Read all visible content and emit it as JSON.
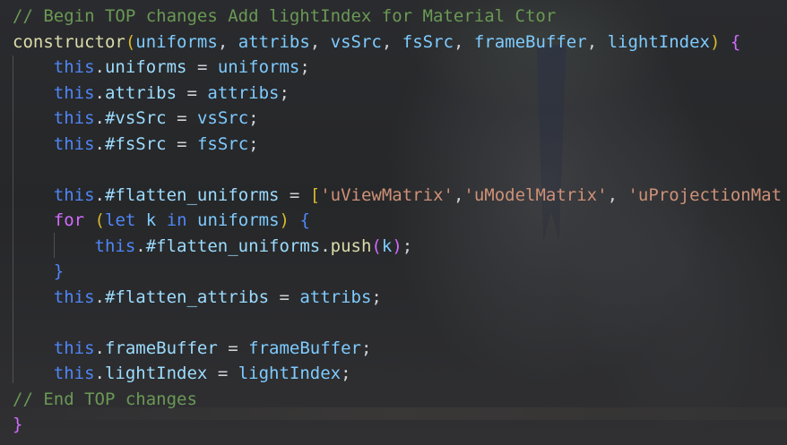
{
  "editor": {
    "lines": [
      {
        "tokens": [
          {
            "t": "// Begin TOP changes Add lightIndex for Material Ctor",
            "c": "cmt"
          }
        ]
      },
      {
        "tokens": [
          {
            "t": "constructor",
            "c": "fn"
          },
          {
            "t": "(",
            "c": "br2"
          },
          {
            "t": "uniforms",
            "c": "var"
          },
          {
            "t": ", ",
            "c": "plain"
          },
          {
            "t": "attribs",
            "c": "var"
          },
          {
            "t": ", ",
            "c": "plain"
          },
          {
            "t": "vsSrc",
            "c": "var"
          },
          {
            "t": ", ",
            "c": "plain"
          },
          {
            "t": "fsSrc",
            "c": "var"
          },
          {
            "t": ", ",
            "c": "plain"
          },
          {
            "t": "frameBuffer",
            "c": "var"
          },
          {
            "t": ", ",
            "c": "plain"
          },
          {
            "t": "lightIndex",
            "c": "var"
          },
          {
            "t": ")",
            "c": "br2"
          },
          {
            "t": " ",
            "c": "plain"
          },
          {
            "t": "{",
            "c": "br1"
          }
        ]
      },
      {
        "tokens": [
          {
            "t": "    ",
            "c": "plain"
          },
          {
            "t": "this",
            "c": "kw"
          },
          {
            "t": ".",
            "c": "plain"
          },
          {
            "t": "uniforms",
            "c": "prop"
          },
          {
            "t": " = ",
            "c": "plain"
          },
          {
            "t": "uniforms",
            "c": "var"
          },
          {
            "t": ";",
            "c": "plain"
          }
        ]
      },
      {
        "tokens": [
          {
            "t": "    ",
            "c": "plain"
          },
          {
            "t": "this",
            "c": "kw"
          },
          {
            "t": ".",
            "c": "plain"
          },
          {
            "t": "attribs",
            "c": "prop"
          },
          {
            "t": " = ",
            "c": "plain"
          },
          {
            "t": "attribs",
            "c": "var"
          },
          {
            "t": ";",
            "c": "plain"
          }
        ]
      },
      {
        "tokens": [
          {
            "t": "    ",
            "c": "plain"
          },
          {
            "t": "this",
            "c": "kw"
          },
          {
            "t": ".",
            "c": "plain"
          },
          {
            "t": "#vsSrc",
            "c": "prop"
          },
          {
            "t": " = ",
            "c": "plain"
          },
          {
            "t": "vsSrc",
            "c": "var"
          },
          {
            "t": ";",
            "c": "plain"
          }
        ]
      },
      {
        "tokens": [
          {
            "t": "    ",
            "c": "plain"
          },
          {
            "t": "this",
            "c": "kw"
          },
          {
            "t": ".",
            "c": "plain"
          },
          {
            "t": "#fsSrc",
            "c": "prop"
          },
          {
            "t": " = ",
            "c": "plain"
          },
          {
            "t": "fsSrc",
            "c": "var"
          },
          {
            "t": ";",
            "c": "plain"
          }
        ]
      },
      {
        "tokens": []
      },
      {
        "tokens": [
          {
            "t": "    ",
            "c": "plain"
          },
          {
            "t": "this",
            "c": "kw"
          },
          {
            "t": ".",
            "c": "plain"
          },
          {
            "t": "#flatten_uniforms",
            "c": "prop"
          },
          {
            "t": " = ",
            "c": "plain"
          },
          {
            "t": "[",
            "c": "br2"
          },
          {
            "t": "'uViewMatrix'",
            "c": "str"
          },
          {
            "t": ",",
            "c": "plain"
          },
          {
            "t": "'uModelMatrix'",
            "c": "str"
          },
          {
            "t": ", ",
            "c": "plain"
          },
          {
            "t": "'uProjectionMat",
            "c": "str"
          }
        ]
      },
      {
        "tokens": [
          {
            "t": "    ",
            "c": "plain"
          },
          {
            "t": "for",
            "c": "br1"
          },
          {
            "t": " ",
            "c": "plain"
          },
          {
            "t": "(",
            "c": "br2"
          },
          {
            "t": "let",
            "c": "kw"
          },
          {
            "t": " ",
            "c": "plain"
          },
          {
            "t": "k",
            "c": "var"
          },
          {
            "t": " ",
            "c": "plain"
          },
          {
            "t": "in",
            "c": "kw"
          },
          {
            "t": " ",
            "c": "plain"
          },
          {
            "t": "uniforms",
            "c": "var"
          },
          {
            "t": ")",
            "c": "br2"
          },
          {
            "t": " ",
            "c": "plain"
          },
          {
            "t": "{",
            "c": "kw"
          }
        ]
      },
      {
        "tokens": [
          {
            "t": "        ",
            "c": "plain"
          },
          {
            "t": "this",
            "c": "kw"
          },
          {
            "t": ".",
            "c": "plain"
          },
          {
            "t": "#flatten_uniforms",
            "c": "prop"
          },
          {
            "t": ".",
            "c": "plain"
          },
          {
            "t": "push",
            "c": "fn"
          },
          {
            "t": "(",
            "c": "br1"
          },
          {
            "t": "k",
            "c": "var"
          },
          {
            "t": ")",
            "c": "br1"
          },
          {
            "t": ";",
            "c": "plain"
          }
        ]
      },
      {
        "tokens": [
          {
            "t": "    ",
            "c": "plain"
          },
          {
            "t": "}",
            "c": "kw"
          }
        ]
      },
      {
        "tokens": [
          {
            "t": "    ",
            "c": "plain"
          },
          {
            "t": "this",
            "c": "kw"
          },
          {
            "t": ".",
            "c": "plain"
          },
          {
            "t": "#flatten_attribs",
            "c": "prop"
          },
          {
            "t": " = ",
            "c": "plain"
          },
          {
            "t": "attribs",
            "c": "var"
          },
          {
            "t": ";",
            "c": "plain"
          }
        ]
      },
      {
        "tokens": []
      },
      {
        "tokens": [
          {
            "t": "    ",
            "c": "plain"
          },
          {
            "t": "this",
            "c": "kw"
          },
          {
            "t": ".",
            "c": "plain"
          },
          {
            "t": "frameBuffer",
            "c": "prop"
          },
          {
            "t": " = ",
            "c": "plain"
          },
          {
            "t": "frameBuffer",
            "c": "var"
          },
          {
            "t": ";",
            "c": "plain"
          }
        ]
      },
      {
        "tokens": [
          {
            "t": "    ",
            "c": "plain"
          },
          {
            "t": "this",
            "c": "kw"
          },
          {
            "t": ".",
            "c": "plain"
          },
          {
            "t": "lightIndex",
            "c": "prop"
          },
          {
            "t": " = ",
            "c": "plain"
          },
          {
            "t": "lightIndex",
            "c": "var"
          },
          {
            "t": ";",
            "c": "plain"
          }
        ]
      },
      {
        "tokens": [
          {
            "t": "// End TOP changes",
            "c": "cmt"
          }
        ]
      },
      {
        "tokens": [
          {
            "t": "}",
            "c": "br1"
          }
        ]
      }
    ]
  }
}
